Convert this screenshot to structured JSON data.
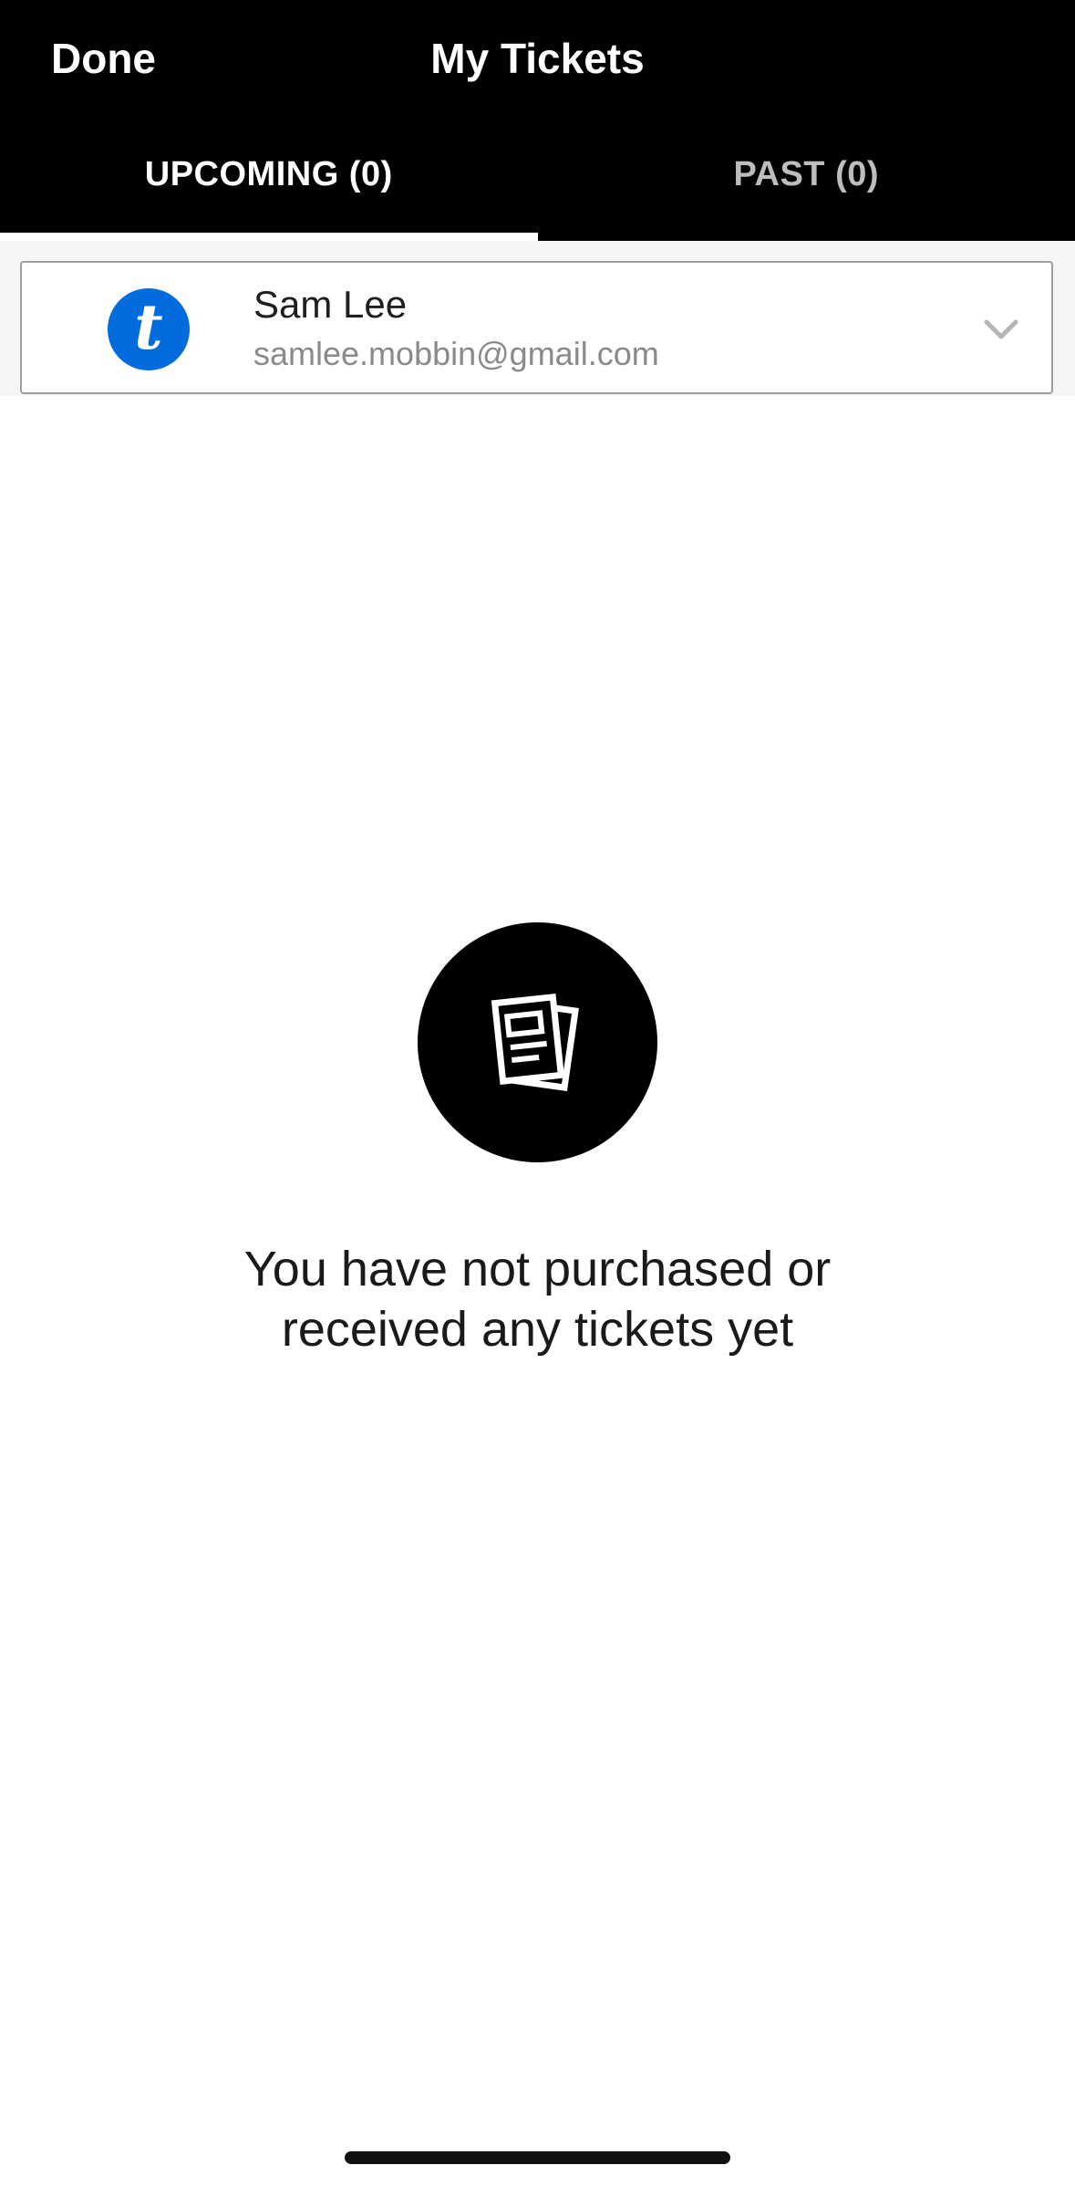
{
  "header": {
    "done_label": "Done",
    "title": "My Tickets"
  },
  "tabs": [
    {
      "label": "UPCOMING (0)",
      "active": true
    },
    {
      "label": "PAST (0)",
      "active": false
    }
  ],
  "account": {
    "logo_letter": "t",
    "name": "Sam Lee",
    "email": "samlee.mobbin@gmail.com",
    "expand_icon": "chevron-down-icon"
  },
  "empty_state": {
    "icon": "tickets-icon",
    "message_line1": "You have not purchased or",
    "message_line2": "received any tickets yet"
  },
  "colors": {
    "header_bg": "#000000",
    "brand_blue": "#026cdf",
    "inactive_tab": "#bdbdbd"
  }
}
